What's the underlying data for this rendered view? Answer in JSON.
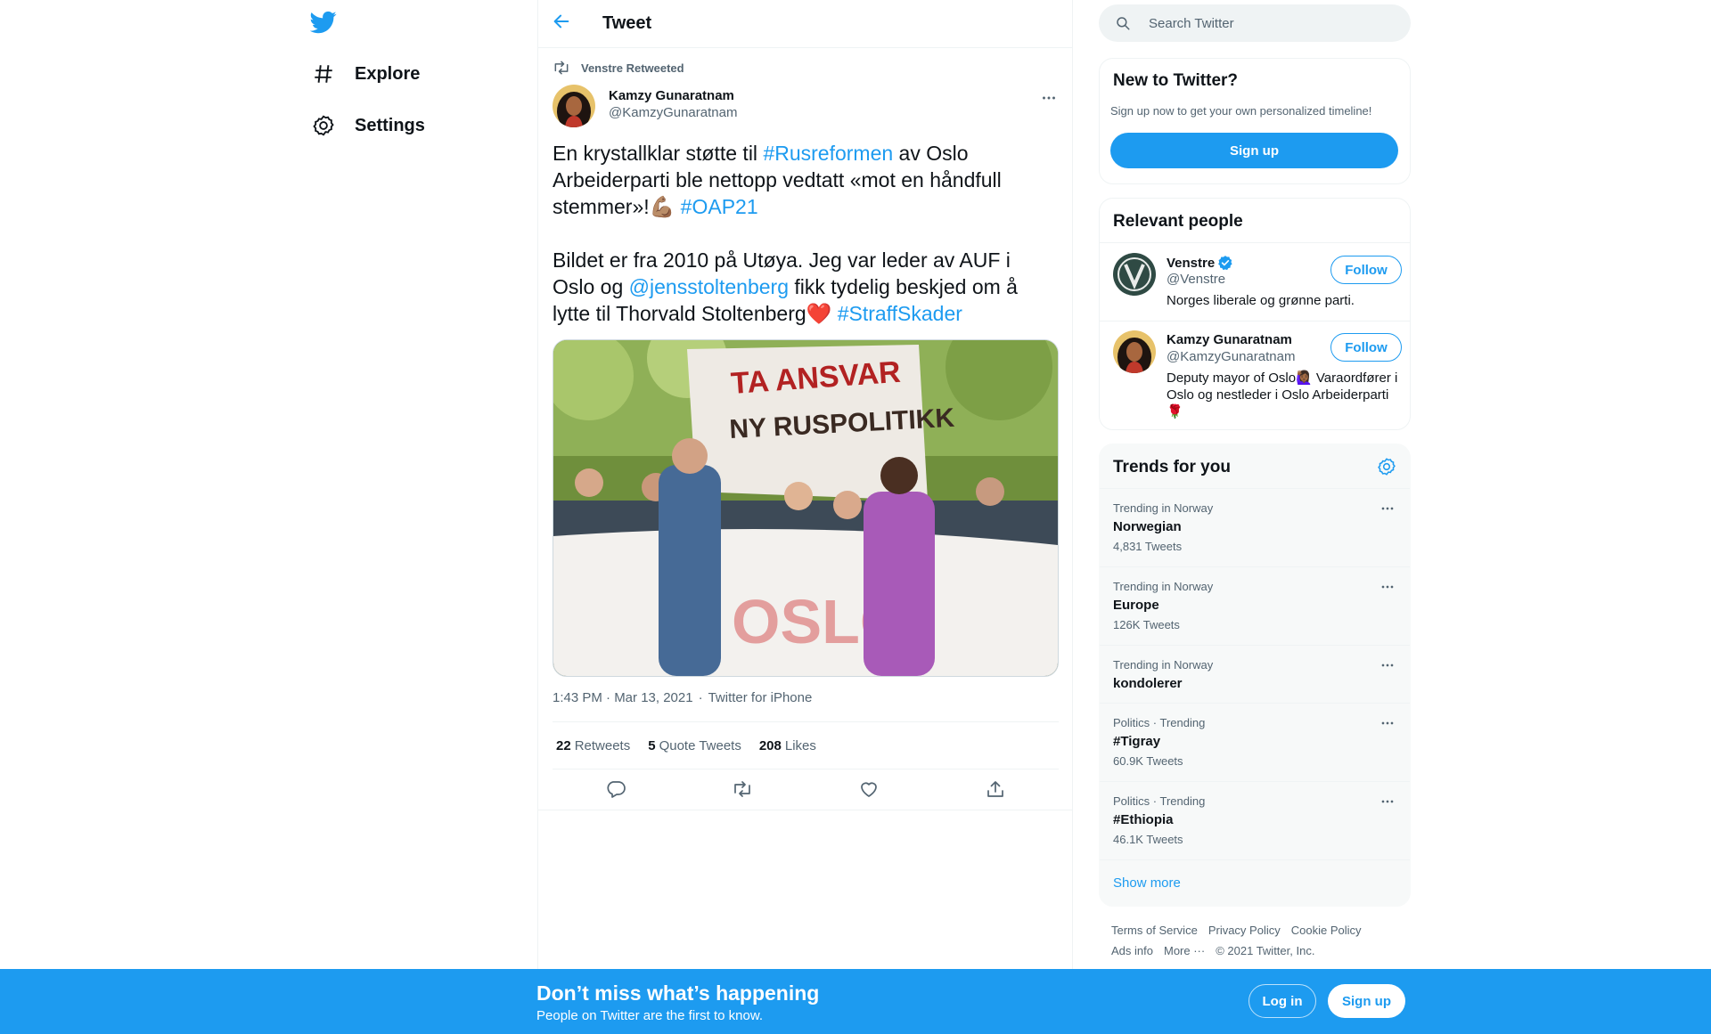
{
  "colors": {
    "accent": "#1d9bf0",
    "text": "#0f1419",
    "muted": "#536471",
    "border": "#eff3f4",
    "heart": "#e0245e"
  },
  "nav": {
    "logo_icon": "twitter-bird-icon",
    "items": [
      {
        "label": "Explore",
        "icon": "hashtag-icon"
      },
      {
        "label": "Settings",
        "icon": "gear-icon"
      }
    ]
  },
  "header": {
    "title": "Tweet",
    "back_icon": "arrow-left-icon"
  },
  "tweet": {
    "social_context": "Venstre Retweeted",
    "author": {
      "name": "Kamzy Gunaratnam",
      "handle": "@KamzyGunaratnam"
    },
    "text": {
      "p1": {
        "t1": "En krystallklar støtte til ",
        "l1": "#Rusreformen",
        "t2": " av Oslo Arbeiderparti ble nettopp vedtatt «mot en håndfull stemmer»!💪🏽 ",
        "l2": "#OAP21"
      },
      "p2": {
        "t1": "Bildet er fra 2010 på Utøya. Jeg var leder av AUF i Oslo og ",
        "l1": "@jensstoltenberg",
        "t2": " fikk tydelig beskjed om å lytte til Thorvald Stoltenberg",
        "emoji": "❤️",
        "t3": " ",
        "l2": "#StraffSkader"
      }
    },
    "photo_text": {
      "banner1": "TA ANSVAR",
      "banner2": "NY RUSPOLITIKK",
      "banner3": "OSLO"
    },
    "timestamp": "1:43 PM · Mar 13, 2021",
    "source": "Twitter for iPhone",
    "stats": [
      {
        "count": "22",
        "label": "Retweets"
      },
      {
        "count": "5",
        "label": "Quote Tweets"
      },
      {
        "count": "208",
        "label": "Likes"
      }
    ]
  },
  "search": {
    "placeholder": "Search Twitter"
  },
  "new_to_twitter": {
    "title": "New to Twitter?",
    "description": "Sign up now to get your own personalized timeline!",
    "button": "Sign up"
  },
  "relevant_people": {
    "title": "Relevant people",
    "people": [
      {
        "name": "Venstre",
        "handle": "@Venstre",
        "verified": true,
        "bio": "Norges liberale og grønne parti.",
        "button": "Follow"
      },
      {
        "name": "Kamzy Gunaratnam",
        "handle": "@KamzyGunaratnam",
        "verified": false,
        "bio": "Deputy mayor of Oslo🙋🏾‍♀️ Varaordfører i Oslo og nestleder i Oslo Arbeiderparti🌹",
        "button": "Follow"
      }
    ]
  },
  "trends": {
    "title": "Trends for you",
    "items": [
      {
        "context": "Trending in Norway",
        "name": "Norwegian",
        "count": "4,831 Tweets"
      },
      {
        "context": "Trending in Norway",
        "name": "Europe",
        "count": "126K Tweets"
      },
      {
        "context": "Trending in Norway",
        "name": "kondolerer",
        "count": ""
      },
      {
        "context": "Politics · Trending",
        "name": "#Tigray",
        "count": "60.9K Tweets"
      },
      {
        "context": "Politics · Trending",
        "name": "#Ethiopia",
        "count": "46.1K Tweets"
      }
    ],
    "show_more": "Show more"
  },
  "footer": {
    "links": [
      "Terms of Service",
      "Privacy Policy",
      "Cookie Policy",
      "Ads info",
      "More ···"
    ],
    "copyright": "© 2021 Twitter, Inc."
  },
  "bottom_bar": {
    "title": "Don’t miss what’s happening",
    "subtitle": "People on Twitter are the first to know.",
    "login": "Log in",
    "signup": "Sign up"
  }
}
